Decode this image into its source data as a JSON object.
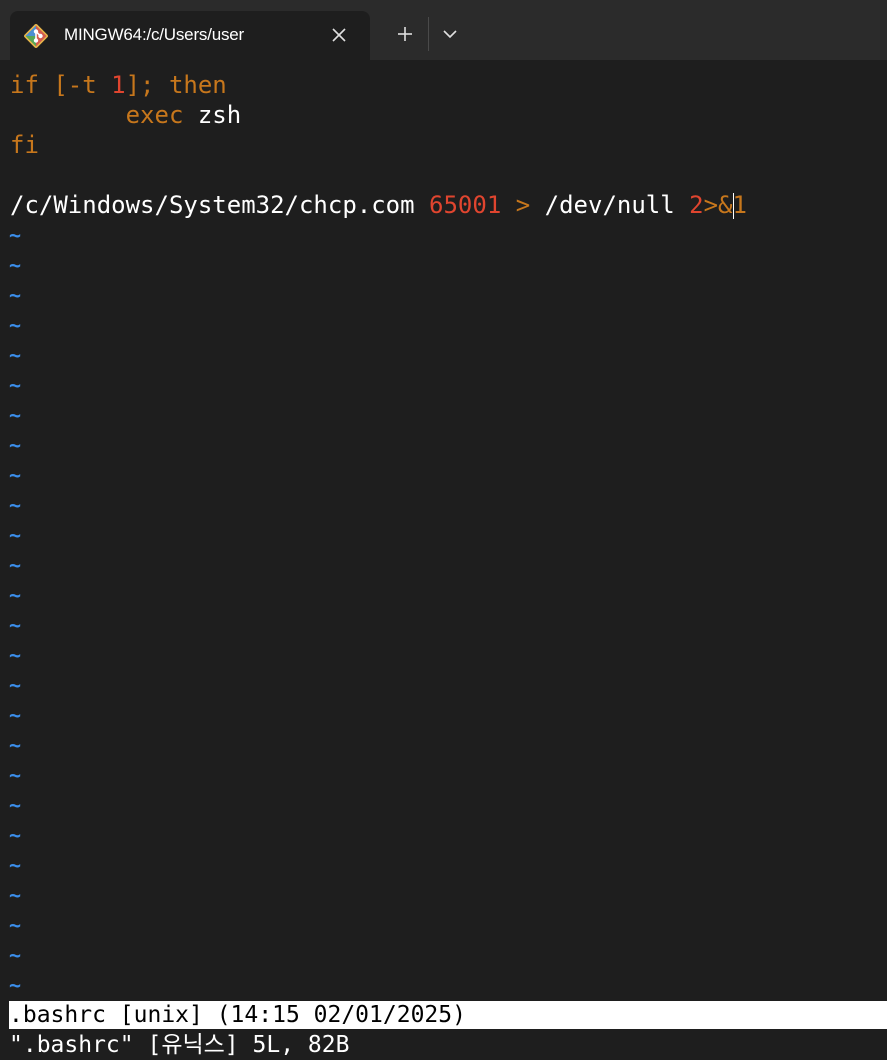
{
  "tab": {
    "title": "MINGW64:/c/Users/user",
    "icon": "git-icon",
    "close_icon": "close-icon"
  },
  "tabbar": {
    "new_tab_icon": "plus-icon",
    "dropdown_icon": "chevron-down-icon"
  },
  "editor": {
    "line1": {
      "kw_if": "if ",
      "kw_bracket_open": "[-t ",
      "num_1": "1",
      "kw_then": "]; then"
    },
    "line2": {
      "indent": "        ",
      "kw_exec": "exec",
      "txt_zsh": " zsh"
    },
    "line3": {
      "kw_fi": "fi"
    },
    "line5": {
      "path": "/c/Windows/System32/chcp.com ",
      "num_code": "65001",
      "redir": " > ",
      "dev_null": "/dev/null ",
      "num_2": "2",
      "redir2": ">&",
      "num_last": "1"
    },
    "tilde": "~",
    "tilde_count": 26
  },
  "vim": {
    "statusline": ".bashrc [unix] (14:15 02/01/2025)",
    "message": "\".bashrc\" [유닉스] 5L, 82B"
  },
  "colors": {
    "background": "#1e1e1e",
    "keyword": "#c7771c",
    "number": "#e0452f",
    "tilde": "#3b8eea"
  }
}
